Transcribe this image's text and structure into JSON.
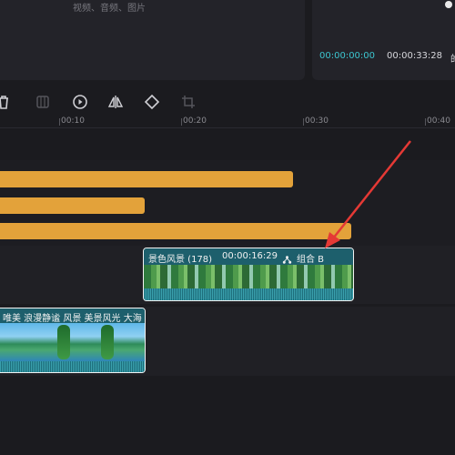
{
  "media_panel": {
    "hint": "视频、音频、图片"
  },
  "preview": {
    "time_current": "00:00:00:00",
    "time_total": "00:00:33:28",
    "cut_char": "的"
  },
  "toolbar": {
    "icons": [
      "delete-icon",
      "freeze-frame-icon",
      "play-reverse-icon",
      "mirror-icon",
      "rotate-icon",
      "crop-icon"
    ]
  },
  "ruler": {
    "labels": [
      "00:10",
      "00:20",
      "00:30",
      "00:40"
    ]
  },
  "timeline": {
    "audio_tracks": 3,
    "group_clip": {
      "name": "景色风景 (178)",
      "duration": "00:00:16:29",
      "group_label": "组合 B"
    },
    "main_clip": {
      "name": "唯美 浪漫静谧 风景 美景风光 大海"
    }
  },
  "colors": {
    "accent": "#3cc6d0",
    "audio": "#e3a23a",
    "clip": "#1c6571",
    "arrow": "#e53935"
  }
}
